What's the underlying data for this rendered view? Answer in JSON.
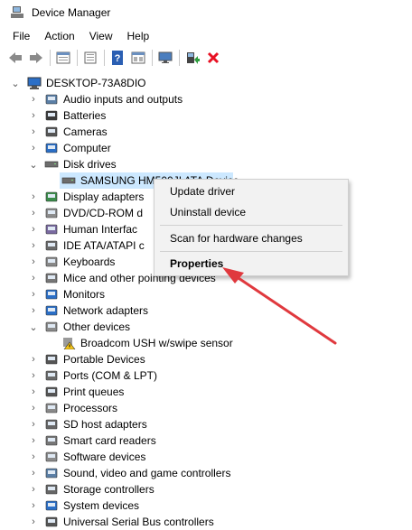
{
  "window": {
    "title": "Device Manager"
  },
  "menu": [
    "File",
    "Action",
    "View",
    "Help"
  ],
  "toolbar": [
    "back-icon",
    "forward-icon",
    "properties-icon",
    "refresh-icon",
    "help-icon",
    "device-view-icon",
    "monitor-icon",
    "update-driver-icon",
    "uninstall-icon"
  ],
  "tree": {
    "root": "DESKTOP-73A8DIO",
    "items": [
      {
        "label": "Audio inputs and outputs",
        "icon": "speaker-icon"
      },
      {
        "label": "Batteries",
        "icon": "battery-icon"
      },
      {
        "label": "Cameras",
        "icon": "camera-icon"
      },
      {
        "label": "Computer",
        "icon": "computer-icon"
      },
      {
        "label": "Disk drives",
        "icon": "disk-drive-icon"
      },
      {
        "label": "SAMSUNG HM500JI ATA Device",
        "icon": "disk-drive-icon"
      },
      {
        "label": "Display adapters",
        "icon": "display-adapter-icon"
      },
      {
        "label": "DVD/CD-ROM d",
        "icon": "dvd-icon"
      },
      {
        "label": "Human Interfac",
        "icon": "hid-icon"
      },
      {
        "label": "IDE ATA/ATAPI c",
        "icon": "ide-icon"
      },
      {
        "label": "Keyboards",
        "icon": "keyboard-icon"
      },
      {
        "label": "Mice and other pointing devices",
        "icon": "mouse-icon"
      },
      {
        "label": "Monitors",
        "icon": "monitor-icon"
      },
      {
        "label": "Network adapters",
        "icon": "network-icon"
      },
      {
        "label": "Other devices",
        "icon": "other-devices-icon"
      },
      {
        "label": "Broadcom USH w/swipe sensor",
        "icon": "warning-device-icon"
      },
      {
        "label": "Portable Devices",
        "icon": "portable-icon"
      },
      {
        "label": "Ports (COM & LPT)",
        "icon": "port-icon"
      },
      {
        "label": "Print queues",
        "icon": "printer-icon"
      },
      {
        "label": "Processors",
        "icon": "processor-icon"
      },
      {
        "label": "SD host adapters",
        "icon": "sd-icon"
      },
      {
        "label": "Smart card readers",
        "icon": "smartcard-icon"
      },
      {
        "label": "Software devices",
        "icon": "software-icon"
      },
      {
        "label": "Sound, video and game controllers",
        "icon": "sound-icon"
      },
      {
        "label": "Storage controllers",
        "icon": "storage-icon"
      },
      {
        "label": "System devices",
        "icon": "system-icon"
      },
      {
        "label": "Universal Serial Bus controllers",
        "icon": "usb-icon"
      }
    ]
  },
  "context_menu": {
    "items": [
      "Update driver",
      "Uninstall device",
      "Scan for hardware changes",
      "Properties"
    ]
  },
  "colors": {
    "selection": "#cce8ff",
    "arrow": "#e0393e",
    "uninstall": "#e81123"
  }
}
